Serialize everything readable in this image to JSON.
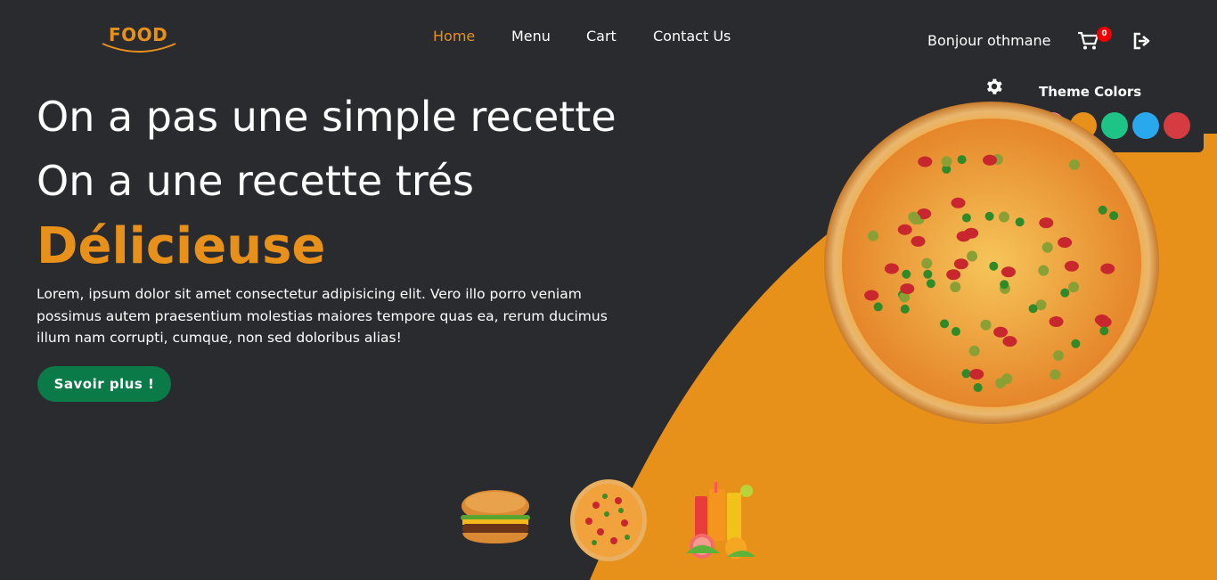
{
  "nav": {
    "logo": "FOOD",
    "links": [
      "Home",
      "Menu",
      "Cart",
      "Contact Us"
    ],
    "active": "Home",
    "greeting": "Bonjour othmane",
    "cart_count": "0"
  },
  "theme": {
    "title": "Theme Colors",
    "colors": [
      "#f7869f",
      "#e8911a",
      "#1dc486",
      "#2aa8ee",
      "#d43c41"
    ]
  },
  "hero": {
    "line1": "On a pas une simple recette",
    "line2": "On a une recette trés",
    "line3": "Délicieuse",
    "description": "Lorem, ipsum dolor sit amet consectetur adipisicing elit. Vero illo porro veniam possimus autem praesentium molestias maiores tempore quas ea, rerum ducimus illum nam corrupti, cumque, non sed doloribus alias!",
    "cta": "Savoir plus !"
  },
  "colors": {
    "accent": "#e8911a",
    "background": "#2a2b2f",
    "cta": "#0a7a48"
  },
  "thumbnails": [
    "burger-image",
    "pizza-image",
    "juice-image"
  ]
}
